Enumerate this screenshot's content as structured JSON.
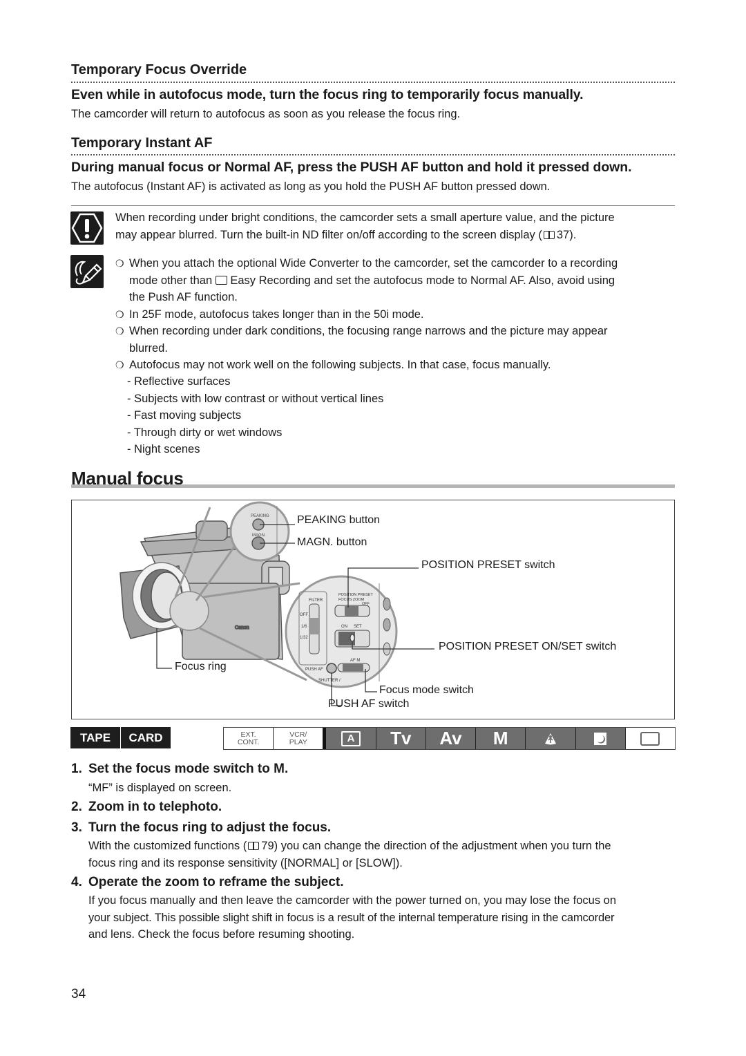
{
  "sections": {
    "temporary_focus_override": {
      "heading": "Temporary Focus Override",
      "lead": "Even while in autofocus mode, turn the focus ring to temporarily focus manually.",
      "body": "The camcorder will return to autofocus as soon as you release the focus ring."
    },
    "temporary_instant_af": {
      "heading": "Temporary Instant AF",
      "lead": "During manual focus or Normal AF, press the PUSH AF button and hold it pressed down.",
      "body": "The autofocus (Instant AF) is activated as long as you hold the PUSH AF button pressed down."
    }
  },
  "caution": {
    "icon": "caution-icon",
    "text_1": "When recording under bright conditions, the camcorder sets a small aperture value, and the picture",
    "text_2": "may appear blurred. Turn the built-in ND filter on/off according to the screen display (",
    "page_ref": "37",
    "text_end": ")."
  },
  "notes": {
    "icon": "note-pencil-icon",
    "bullet_glyph": "❍",
    "items": [
      {
        "line_1": "When you attach the optional Wide Converter to the camcorder, set the camcorder to a recording",
        "line_2a": "mode other than ",
        "line_2b": " Easy Recording and set the autofocus mode to Normal AF. Also, avoid using",
        "line_3": "the Push AF function."
      },
      {
        "line_1": "In 25F mode, autofocus takes longer than in the 50i mode."
      },
      {
        "line_1": "When recording under dark conditions, the focusing range narrows and the picture may appear",
        "line_2": "blurred."
      },
      {
        "line_1": "Autofocus may not work well on the following subjects. In that case, focus manually."
      }
    ],
    "subjects": [
      "Reflective surfaces",
      "Subjects with low contrast or without vertical lines",
      "Fast moving subjects",
      "Through dirty or wet windows",
      "Night scenes"
    ]
  },
  "manual_focus": {
    "title": "Manual focus",
    "figure": {
      "callouts": {
        "peaking": "PEAKING button",
        "magn": "MAGN. button",
        "position_preset": "POSITION PRESET switch",
        "position_preset_onset": "POSITION PRESET ON/SET switch",
        "focus_ring": "Focus ring",
        "focus_mode": "Focus mode switch",
        "push_af": "PUSH AF switch"
      },
      "panel_labels": {
        "peaking": "PEAKING",
        "magn": "MAGN.",
        "filter": "FILTER",
        "off": "OFF",
        "one_sixth": "1/6",
        "one_32": "1/32",
        "position_preset": "POSITION PRESET",
        "focus_zoom": "FOCUS ZOOM",
        "pp_off": "OFF",
        "on": "ON",
        "set": "SET",
        "af_m": "AF M",
        "push_af": "PUSH AF",
        "shutter": "SHUTTER /",
        "brand": "Canon"
      }
    },
    "media": [
      "TAPE",
      "CARD"
    ],
    "modes": [
      {
        "label_1": "EXT.",
        "label_2": "CONT.",
        "active": false
      },
      {
        "label_1": "VCR/",
        "label_2": "PLAY",
        "active": false
      },
      {
        "label": "A",
        "icon": "auto-mode-icon",
        "active": true
      },
      {
        "label": "Tv",
        "active": true
      },
      {
        "label": "Av",
        "active": true
      },
      {
        "label": "M",
        "active": true
      },
      {
        "icon": "spotlight-scene-icon",
        "active": true
      },
      {
        "icon": "night-scene-icon",
        "active": true
      },
      {
        "icon": "easy-recording-icon",
        "active": false
      }
    ],
    "steps": [
      {
        "num": "1.",
        "heading": "Set the focus mode switch to M.",
        "body": "“MF” is displayed on screen."
      },
      {
        "num": "2.",
        "heading": "Zoom in to telephoto."
      },
      {
        "num": "3.",
        "heading": "Turn the focus ring to adjust the focus.",
        "body_1a": "With the customized functions (",
        "page_ref": "79",
        "body_1b": ") you can change the direction of the adjustment when you turn the",
        "body_2": "focus ring and its response sensitivity ([NORMAL] or [SLOW])."
      },
      {
        "num": "4.",
        "heading": "Operate the zoom to reframe the subject.",
        "body_1": "If you focus manually and then leave the camcorder with the power turned on, you may lose the focus on",
        "body_2": "your subject. This possible slight shift in focus is a result of the internal temperature rising in the camcorder",
        "body_3": "and lens. Check the focus before resuming shooting."
      }
    ]
  },
  "page_number": "34"
}
